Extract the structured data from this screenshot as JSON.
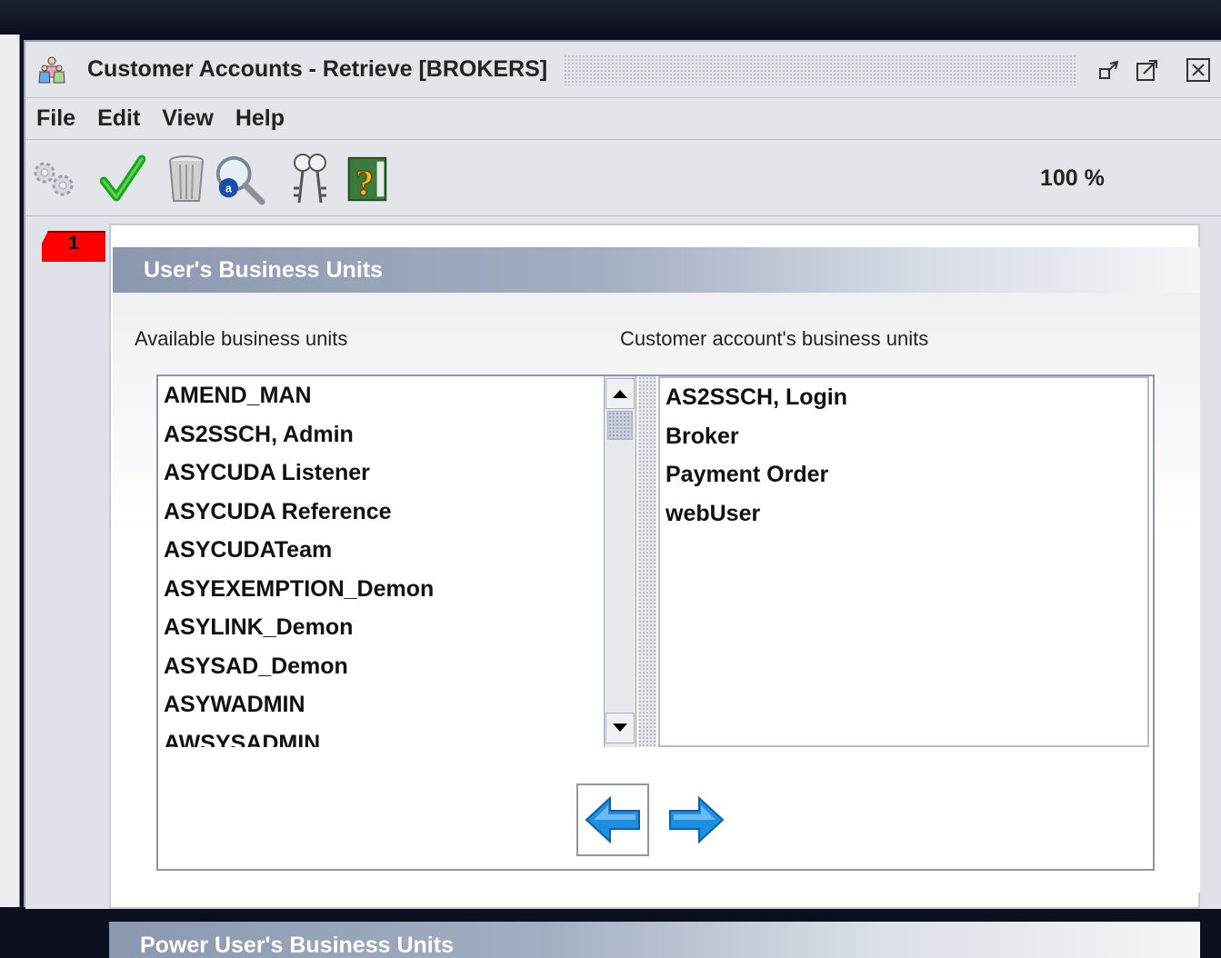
{
  "window": {
    "title": "Customer Accounts - Retrieve [BROKERS]"
  },
  "menu": {
    "items": [
      "File",
      "Edit",
      "View",
      "Help"
    ]
  },
  "toolbar": {
    "zoom": "100 %",
    "icons": [
      "gears-icon",
      "checkmark-icon",
      "trash-can-icon",
      "search-icon",
      "keys-icon",
      "help-icon"
    ]
  },
  "tab": {
    "number": "1"
  },
  "business_units": {
    "header": "User's Business Units",
    "available_label": "Available business units",
    "assigned_label": "Customer account's business units",
    "available": [
      "AMEND_MAN",
      "AS2SSCH, Admin",
      "ASYCUDA Listener",
      "ASYCUDA Reference",
      "ASYCUDATeam",
      "ASYEXEMPTION_Demon",
      "ASYLINK_Demon",
      "ASYSAD_Demon",
      "ASYWADMIN",
      "AWSYSADMIN"
    ],
    "assigned": [
      "AS2SSCH, Login",
      "Broker",
      "Payment Order",
      "webUser"
    ]
  },
  "power_users": {
    "header": "Power User's Business Units"
  },
  "colors": {
    "section_header_start": "#8c98b0",
    "tab_marker": "#ff0000",
    "arrow_blue": "#1e8fe0"
  }
}
